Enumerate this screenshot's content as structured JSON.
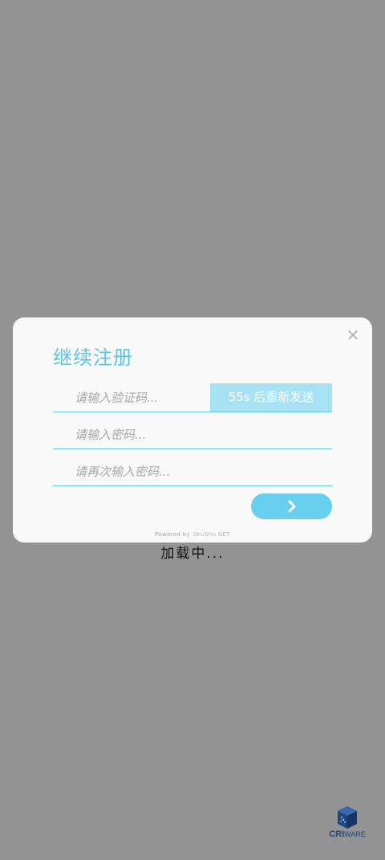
{
  "dialog": {
    "title": "继续注册",
    "close_icon": "close-icon",
    "verify_code": {
      "placeholder": "请输入验证码...",
      "value": ""
    },
    "resend_label": "55s 后重新发送",
    "password": {
      "placeholder": "请输入密码...",
      "value": ""
    },
    "password_confirm": {
      "placeholder": "请再次输入密码...",
      "value": ""
    },
    "next_icon": "chevron-right-icon",
    "powered_by": "Powered by",
    "powered_brand": "ShuShu NET"
  },
  "loading_text": "加载中...",
  "logo": {
    "text_bold": "CRI",
    "text_light": "WARE"
  },
  "colors": {
    "backdrop": "#939393",
    "accent": "#5cc4e6",
    "resend_bg": "#a6e2f4",
    "next_bg": "#68d0ee",
    "logo": "#21467e"
  }
}
